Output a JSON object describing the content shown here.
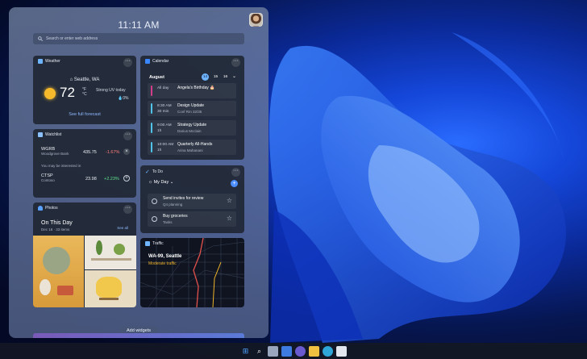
{
  "clock": "11:11 AM",
  "search": {
    "placeholder": "Search or enter web address"
  },
  "weather": {
    "title": "Weather",
    "location": "Seattle, WA",
    "temp": "72",
    "unit_f": "°F",
    "unit_c": "°C",
    "condition": "Strong UV today",
    "precip": "0%",
    "link": "See full forecast"
  },
  "watchlist": {
    "title": "Watchlist",
    "stocks": [
      {
        "symbol": "WGRB",
        "name": "Woodgrove Bank",
        "price": "435.75",
        "change": "-1.67%"
      },
      {
        "symbol": "CTSP",
        "name": "Contoso",
        "price": "23.98",
        "change": "+2.23%"
      }
    ],
    "interest_text": "You may be interested in"
  },
  "photos": {
    "title": "Photos",
    "heading": "On This Day",
    "sub": "Dec 18 · 33 items",
    "see_all": "See all"
  },
  "calendar": {
    "title": "Calendar",
    "month": "August",
    "days": [
      "14",
      "15",
      "16"
    ],
    "events": [
      {
        "time": "All day",
        "duration": "",
        "title": "Angela's Birthday 🎂",
        "sub": "",
        "color": "#d63c8c"
      },
      {
        "time": "8:30 AM",
        "duration": "30 min",
        "title": "Design Update",
        "sub": "Conf Rm 32/35",
        "color": "#4fc3e8"
      },
      {
        "time": "9:00 AM",
        "duration": "1h",
        "title": "Strategy Update",
        "sub": "Darius Mcclain",
        "color": "#4fc3e8"
      },
      {
        "time": "10:00 AM",
        "duration": "1h",
        "title": "Quarterly All-Hands",
        "sub": "Arina Mahanani",
        "color": "#4fc3e8"
      }
    ]
  },
  "todo": {
    "title": "To Do",
    "list": "My Day",
    "items": [
      {
        "title": "Send invites for review",
        "sub": "Q4 planning"
      },
      {
        "title": "Buy groceries",
        "sub": "Tasks"
      }
    ]
  },
  "traffic": {
    "title": "Traffic",
    "road": "WA-99, Seattle",
    "status": "Moderate traffic"
  },
  "add_widgets": "Add widgets",
  "colors": {
    "accent": "#4c8dff",
    "negative": "#ff7a7a",
    "positive": "#5fe08a"
  }
}
